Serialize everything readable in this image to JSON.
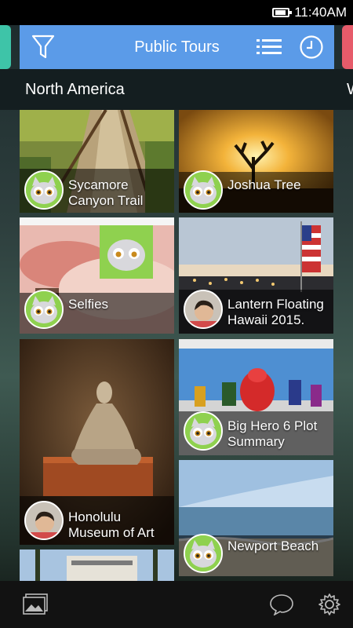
{
  "status_bar": {
    "time": "11:40AM",
    "battery_icon": "battery-icon"
  },
  "header": {
    "title": "Public Tours",
    "filter_icon": "filter-icon",
    "list_icon": "list-icon",
    "clock_icon": "clock-icon"
  },
  "region": {
    "current": "North America",
    "next_partial": "W"
  },
  "tours": [
    {
      "label": "Sycamore Canyon Trail",
      "line1": "Sycamore",
      "line2": "Canyon Trail",
      "avatar": "cat-avatar"
    },
    {
      "label": "Joshua Tree",
      "line1": "Joshua Tree",
      "line2": "",
      "avatar": "cat-avatar"
    },
    {
      "label": "Selfies",
      "line1": "Selfies",
      "line2": "",
      "avatar": "cat-avatar"
    },
    {
      "label": "Lantern Floating Hawaii 2015.",
      "line1": "Lantern Floating",
      "line2": "Hawaii 2015.",
      "avatar": "person-avatar"
    },
    {
      "label": "Honolulu Museum of Art",
      "line1": "Honolulu",
      "line2": "Museum of Art",
      "avatar": "person-avatar"
    },
    {
      "label": "Big Hero 6 Plot Summary",
      "line1": "Big Hero 6 Plot",
      "line2": "Summary",
      "avatar": "cat-avatar"
    },
    {
      "label": "Newport Beach",
      "line1": "Newport Beach",
      "line2": "",
      "avatar": "cat-avatar"
    },
    {
      "label": "",
      "line1": "",
      "line2": "",
      "avatar": ""
    }
  ],
  "bottom_bar": {
    "gallery_icon": "gallery-icon",
    "chat_icon": "chat-bubble-icon",
    "settings_icon": "gear-icon"
  },
  "colors": {
    "header_blue": "#5b9be8",
    "tab_green": "#3ec4a8",
    "tab_red": "#e65b6a",
    "avatar_green": "#8fd14f"
  }
}
